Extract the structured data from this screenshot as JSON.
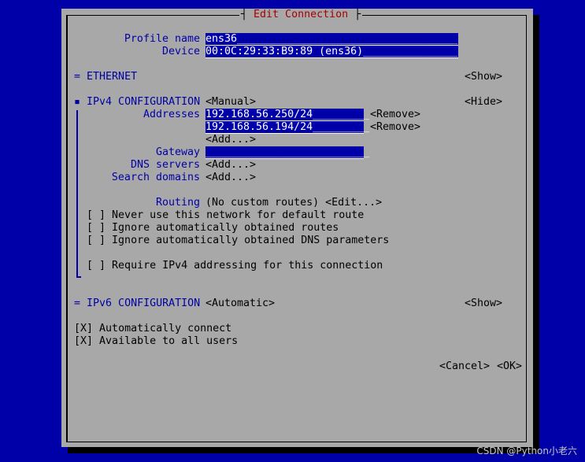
{
  "dialog": {
    "title": "Edit Connection",
    "title_left": "┤",
    "title_right": "├"
  },
  "profile": {
    "name_label": "Profile name",
    "name_value": "ens36___________________________________",
    "device_label": "Device",
    "device_value": "00:0C:29:33:B9:89 (ens36)_______________"
  },
  "ethernet": {
    "marker": "=",
    "label": "ETHERNET",
    "toggle": "<Show>"
  },
  "ipv4": {
    "marker": "▪",
    "label": "IPv4 CONFIGURATION",
    "mode": "<Manual>",
    "toggle": "<Hide>",
    "addresses_label": "Addresses",
    "addresses": [
      {
        "value": "192.168.56.250/24_________",
        "remove": "<Remove>"
      },
      {
        "value": "192.168.56.194/24_________",
        "remove": "<Remove>"
      }
    ],
    "add_address": "<Add...>",
    "gateway_label": "Gateway",
    "gateway_value": "__________________________",
    "dns_label": "DNS servers",
    "dns_add": "<Add...>",
    "search_label": "Search domains",
    "search_add": "<Add...>",
    "routing_label": "Routing",
    "routing_value": "(No custom routes)",
    "routing_edit": "<Edit...>",
    "checks": [
      {
        "box": "[ ]",
        "label": "Never use this network for default route"
      },
      {
        "box": "[ ]",
        "label": "Ignore automatically obtained routes"
      },
      {
        "box": "[ ]",
        "label": "Ignore automatically obtained DNS parameters"
      },
      {
        "box": "[ ]",
        "label": "Require IPv4 addressing for this connection"
      }
    ]
  },
  "ipv6": {
    "marker": "=",
    "label": "IPv6 CONFIGURATION",
    "mode": "<Automatic>",
    "toggle": "<Show>"
  },
  "options": [
    {
      "box": "[X]",
      "label": "Automatically connect"
    },
    {
      "box": "[X]",
      "label": "Available to all users"
    }
  ],
  "buttons": {
    "cancel": "<Cancel>",
    "ok": "<OK>"
  },
  "watermark": "CSDN @Python小老六",
  "colors": {
    "screen_bg": "#0000a8",
    "dialog_bg": "#a8a8a8",
    "label": "#0000a8",
    "title": "#a80000",
    "field_bg": "#0000a8",
    "field_fg": "#ffffff"
  }
}
